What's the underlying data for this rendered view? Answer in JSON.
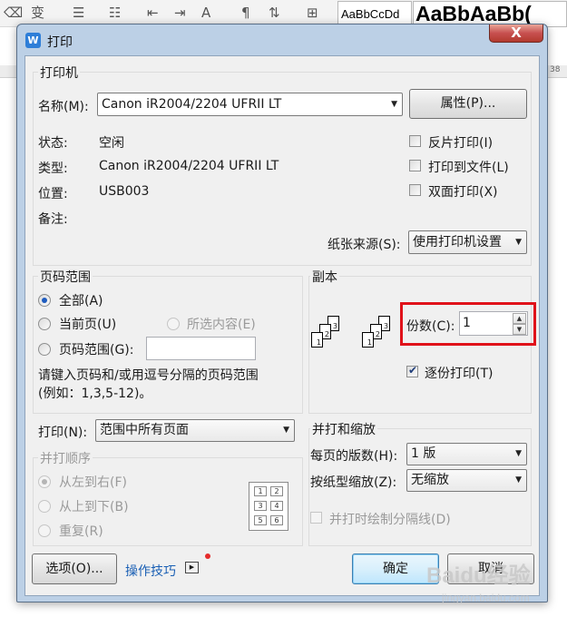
{
  "background": {
    "toolbar_icons": [
      "strikethrough-icon",
      "char-format-icon",
      "bullets-icon",
      "numbering-icon",
      "decrease-indent-icon",
      "increase-indent-icon",
      "char-spacing-icon",
      "paragraph-icon",
      "line-spacing-icon",
      "borders-icon"
    ],
    "style_samples": [
      "AaBbCcDd",
      "AaBbAaBb("
    ],
    "ruler_number": "38"
  },
  "dialog": {
    "title": "打印",
    "close_symbol": "X",
    "printer": {
      "group_label": "打印机",
      "name_label": "名称(M):",
      "name_value": "Canon iR2004/2204 UFRII LT",
      "properties_button": "属性(P)...",
      "status_label": "状态:",
      "status_value": "空闲",
      "type_label": "类型:",
      "type_value": "Canon iR2004/2204 UFRII LT",
      "location_label": "位置:",
      "location_value": "USB003",
      "comment_label": "备注:",
      "options": [
        {
          "label": "反片打印(I)",
          "checked": false
        },
        {
          "label": "打印到文件(L)",
          "checked": false
        },
        {
          "label": "双面打印(X)",
          "checked": false
        }
      ],
      "paper_source_label": "纸张来源(S):",
      "paper_source_value": "使用打印机设置"
    },
    "page_range": {
      "group_label": "页码范围",
      "all": {
        "label": "全部(A)",
        "checked": true
      },
      "current": {
        "label": "当前页(U)",
        "checked": false
      },
      "selection": {
        "label": "所选内容(E)",
        "checked": false,
        "disabled": true
      },
      "pages": {
        "label": "页码范围(G):",
        "checked": false,
        "value": ""
      },
      "hint_line1": "请键入页码和/或用逗号分隔的页码范围",
      "hint_line2": "(例如：1,3,5-12)。"
    },
    "copies": {
      "group_label": "副本",
      "count_label": "份数(C):",
      "count_value": "1",
      "collate_label": "逐份打印(T)",
      "collate_checked": true,
      "collate_pages": [
        "1",
        "2",
        "3"
      ]
    },
    "print_what": {
      "label": "打印(N):",
      "value": "范围中所有页面"
    },
    "merge_order": {
      "group_label": "并打顺序",
      "options": [
        {
          "label": "从左到右(F)",
          "checked": true
        },
        {
          "label": "从上到下(B)",
          "checked": false
        },
        {
          "label": "重复(R)",
          "checked": false
        }
      ],
      "grid_cells": [
        "1",
        "2",
        "3",
        "4",
        "5",
        "6"
      ]
    },
    "zoom": {
      "group_label": "并打和缩放",
      "pages_per_sheet_label": "每页的版数(H):",
      "pages_per_sheet_value": "1 版",
      "scale_label": "按纸型缩放(Z):",
      "scale_value": "无缩放",
      "draw_divider_label": "并打时绘制分隔线(D)"
    },
    "footer": {
      "options_button": "选项(O)...",
      "tips_link": "操作技巧",
      "ok_button": "确定",
      "cancel_button": "取消"
    }
  },
  "watermark": {
    "brand": "Baidu经验",
    "url": "jingyan.baidu.com"
  }
}
